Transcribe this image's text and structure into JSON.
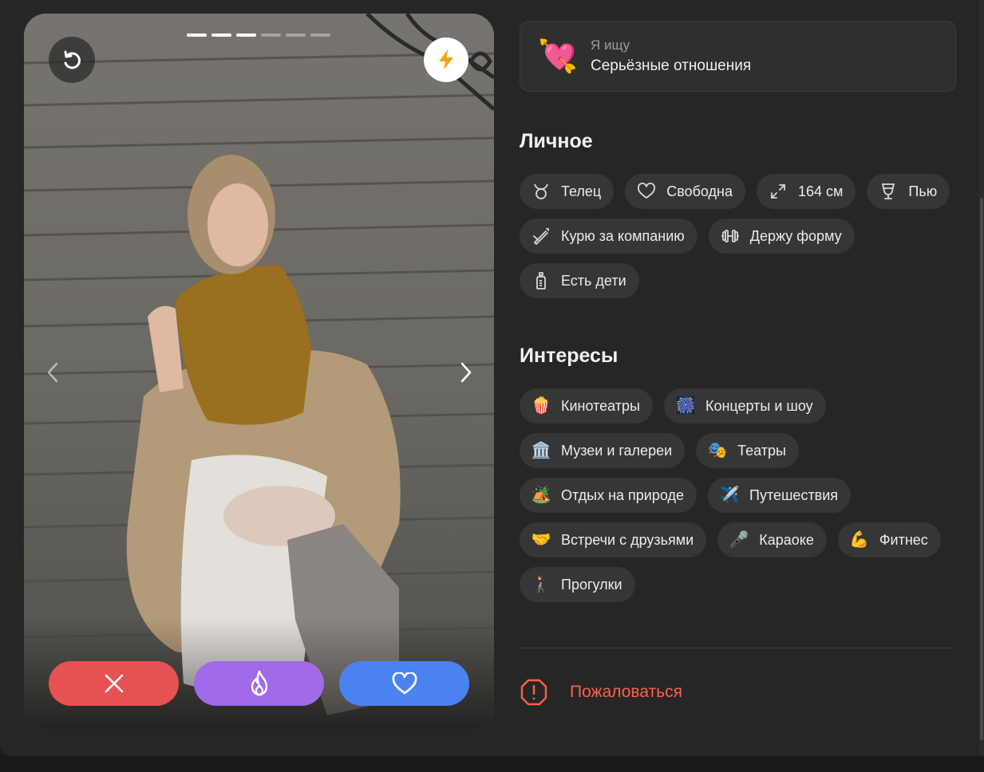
{
  "looking_for": {
    "emoji": "💘",
    "caption": "Я ищу",
    "value": "Серьёзные отношения"
  },
  "photo": {
    "total_photos": 6,
    "current_photo": 3
  },
  "personal": {
    "title": "Личное",
    "items": [
      {
        "icon": "taurus-icon",
        "label": "Телец"
      },
      {
        "icon": "heart-outline-icon",
        "label": "Свободна"
      },
      {
        "icon": "height-icon",
        "label": "164 см"
      },
      {
        "icon": "wine-glass-icon",
        "label": "Пью"
      },
      {
        "icon": "cigarette-icon",
        "label": "Курю за компанию"
      },
      {
        "icon": "dumbbell-icon",
        "label": "Держу форму"
      },
      {
        "icon": "baby-bottle-icon",
        "label": "Есть дети"
      }
    ]
  },
  "interests": {
    "title": "Интересы",
    "items": [
      {
        "emoji": "🍿",
        "label": "Кинотеатры"
      },
      {
        "emoji": "🎆",
        "label": "Концерты и шоу"
      },
      {
        "emoji": "🏛️",
        "label": "Музеи и галереи"
      },
      {
        "emoji": "🎭",
        "label": "Театры"
      },
      {
        "emoji": "🏕️",
        "label": "Отдых на природе"
      },
      {
        "emoji": "✈️",
        "label": "Путешествия"
      },
      {
        "emoji": "🤝",
        "label": "Встречи с друзьями"
      },
      {
        "emoji": "🎤",
        "label": "Караоке"
      },
      {
        "emoji": "💪",
        "label": "Фитнес"
      },
      {
        "emoji": "🚶‍♀️",
        "label": "Прогулки"
      }
    ]
  },
  "report": {
    "label": "Пожаловаться",
    "color": "#ff5f4c"
  },
  "colors": {
    "dislike": "#e65252",
    "superlike": "#a16ae8",
    "like": "#4a82f2",
    "background": "#262626",
    "chip": "#363636"
  }
}
